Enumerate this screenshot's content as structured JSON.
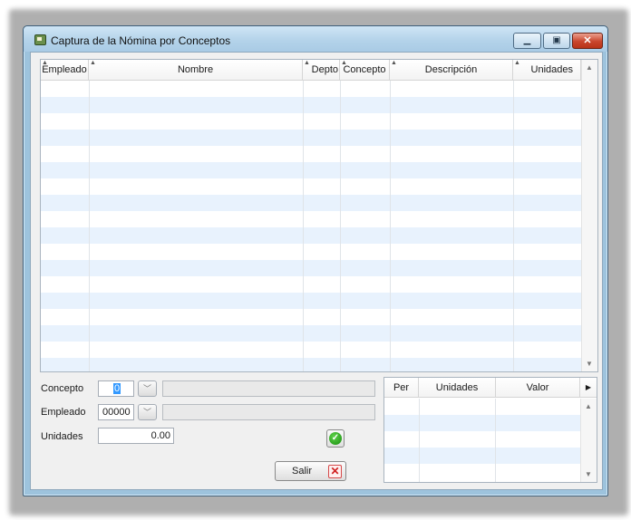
{
  "window": {
    "title": "Captura de la Nómina por Conceptos",
    "buttons": {
      "minimize": "▭",
      "maximize": "▢",
      "close": "✕"
    }
  },
  "grid": {
    "columns": [
      "Empleado",
      "Nombre",
      "Depto",
      "Concepto",
      "Descripción",
      "Unidades"
    ],
    "rows": []
  },
  "form": {
    "concepto_label": "Concepto",
    "concepto_value": "0",
    "empleado_label": "Empleado",
    "empleado_value": "00000",
    "unidades_label": "Unidades",
    "unidades_value": "0.00"
  },
  "buttons": {
    "salir_label": "Salir"
  },
  "mini_grid": {
    "columns": [
      "Per",
      "Unidades",
      "Valor"
    ],
    "rows": []
  },
  "icons": {
    "title": "app-icon",
    "dropdown": "chevron-down-icon",
    "accept": "check-icon",
    "exit": "close-icon"
  }
}
